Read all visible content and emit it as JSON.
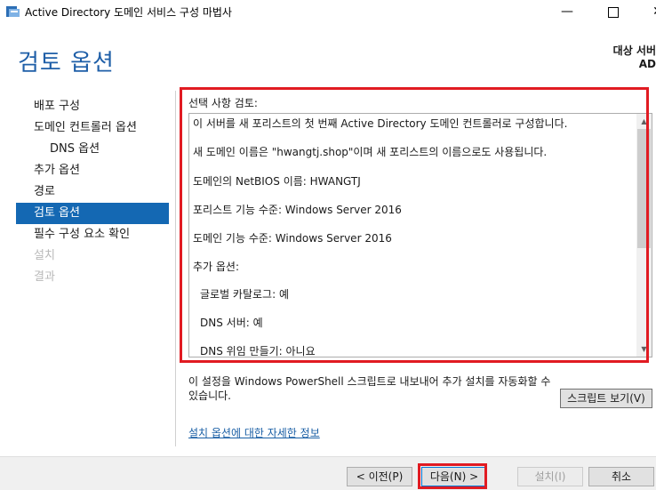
{
  "window": {
    "title": "Active Directory 도메인 서비스 구성 마법사",
    "minimize_glyph": "—",
    "close_glyph": "✕"
  },
  "page": {
    "title": "검토 옵션",
    "target_label": "대상 서버",
    "target_value": "AD"
  },
  "nav": {
    "items": [
      {
        "label": "배포 구성",
        "state": "normal"
      },
      {
        "label": "도메인 컨트롤러 옵션",
        "state": "normal"
      },
      {
        "label": "DNS 옵션",
        "state": "sub"
      },
      {
        "label": "추가 옵션",
        "state": "normal"
      },
      {
        "label": "경로",
        "state": "normal"
      },
      {
        "label": "검토 옵션",
        "state": "active"
      },
      {
        "label": "필수 구성 요소 확인",
        "state": "normal"
      },
      {
        "label": "설치",
        "state": "disabled"
      },
      {
        "label": "결과",
        "state": "disabled"
      }
    ]
  },
  "review": {
    "label": "선택 사항 검토:",
    "lines": [
      "이 서버를 새 포리스트의 첫 번째 Active Directory 도메인 컨트롤러로 구성합니다.",
      "새 도메인 이름은 \"hwangtj.shop\"이며 새 포리스트의 이름으로도 사용됩니다.",
      "도메인의 NetBIOS 이름: HWANGTJ",
      "포리스트 기능 수준: Windows Server 2016",
      "도메인 기능 수준: Windows Server 2016",
      "추가 옵션:",
      "글로벌 카탈로그: 예",
      "DNS 서버: 예",
      "DNS 위임 만들기: 아니요"
    ]
  },
  "export": {
    "text": "이 설정을 Windows PowerShell 스크립트로 내보내어 추가 설치를 자동화할 수 있습니다.",
    "script_button": "스크립트 보기(V)"
  },
  "more_link": "설치 옵션에 대한 자세한 정보",
  "buttons": {
    "prev": "< 이전(P)",
    "next": "다음(N) >",
    "install": "설치(I)",
    "cancel": "취소"
  },
  "colors": {
    "accent": "#1468b3",
    "title": "#1f5fa8",
    "highlight": "#e11b22"
  }
}
